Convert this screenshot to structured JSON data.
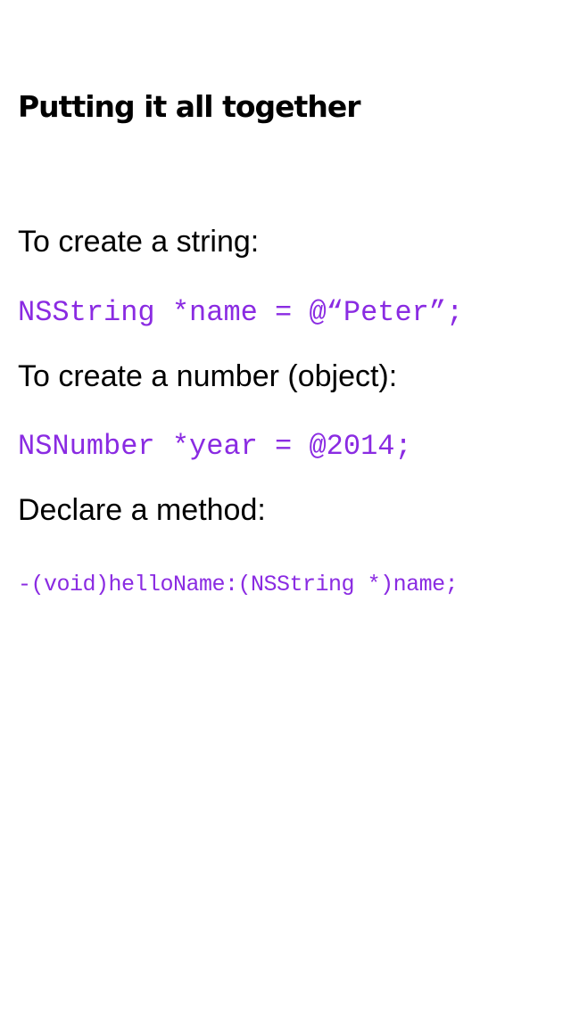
{
  "slide": {
    "title": "Putting it all together",
    "code_color": "#8A2BE2",
    "blocks": [
      {
        "text": "To create a string:",
        "code": "NSString *name = @“Peter”;"
      },
      {
        "text": "To create a number (object):",
        "code": "NSNumber *year = @2014;"
      },
      {
        "text": "Declare a method:",
        "code": "-(void)helloName:(NSString *)name;"
      }
    ]
  }
}
